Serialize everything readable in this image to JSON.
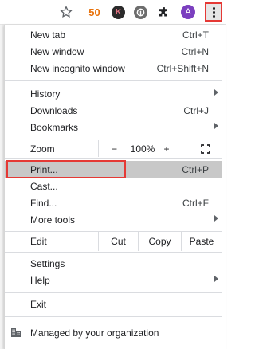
{
  "toolbar": {
    "extensions": [
      "50",
      "K",
      "",
      ""
    ],
    "avatar_letter": "A"
  },
  "menu": {
    "new_tab": {
      "label": "New tab",
      "shortcut": "Ctrl+T"
    },
    "new_window": {
      "label": "New window",
      "shortcut": "Ctrl+N"
    },
    "new_incognito": {
      "label": "New incognito window",
      "shortcut": "Ctrl+Shift+N"
    },
    "history": {
      "label": "History"
    },
    "downloads": {
      "label": "Downloads",
      "shortcut": "Ctrl+J"
    },
    "bookmarks": {
      "label": "Bookmarks"
    },
    "zoom": {
      "label": "Zoom",
      "minus": "−",
      "value": "100%",
      "plus": "+"
    },
    "print": {
      "label": "Print...",
      "shortcut": "Ctrl+P"
    },
    "cast": {
      "label": "Cast..."
    },
    "find": {
      "label": "Find...",
      "shortcut": "Ctrl+F"
    },
    "more_tools": {
      "label": "More tools"
    },
    "edit": {
      "label": "Edit",
      "cut": "Cut",
      "copy": "Copy",
      "paste": "Paste"
    },
    "settings": {
      "label": "Settings"
    },
    "help": {
      "label": "Help"
    },
    "exit": {
      "label": "Exit"
    },
    "managed": {
      "label": "Managed by your organization"
    }
  },
  "colors": {
    "highlight": "#c8c8c8",
    "annotation_red": "#e53935"
  }
}
